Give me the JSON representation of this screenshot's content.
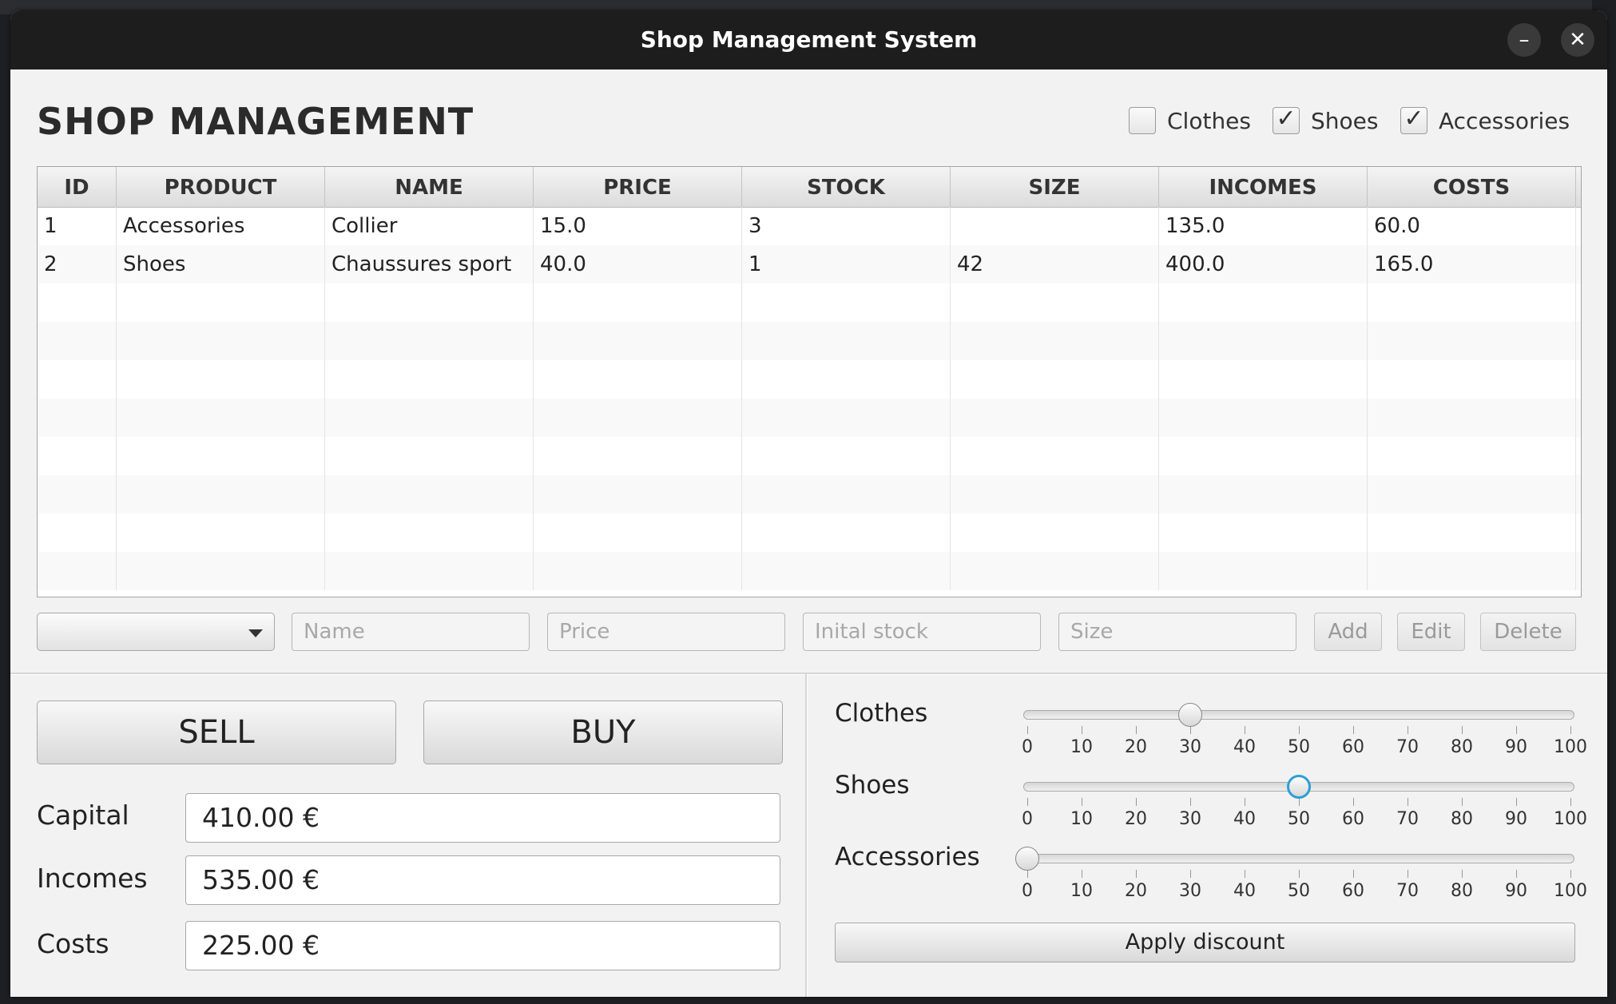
{
  "window": {
    "title": "Shop Management System",
    "minimize_glyph": "–",
    "close_glyph": "✕"
  },
  "heading": "SHOP MANAGEMENT",
  "filters": [
    {
      "label": "Clothes",
      "checked": false
    },
    {
      "label": "Shoes",
      "checked": true
    },
    {
      "label": "Accessories",
      "checked": true
    }
  ],
  "check_glyph": "✓",
  "table": {
    "columns": [
      "ID",
      "PRODUCT",
      "NAME",
      "PRICE",
      "STOCK",
      "SIZE",
      "INCOMES",
      "COSTS"
    ],
    "rows": [
      [
        "1",
        "Accessories",
        "Collier",
        "15.0",
        "3",
        "",
        "135.0",
        "60.0"
      ],
      [
        "2",
        "Shoes",
        "Chaussures sport",
        "40.0",
        "1",
        "42",
        "400.0",
        "165.0"
      ]
    ]
  },
  "form": {
    "product_combo_value": "",
    "name_placeholder": "Name",
    "price_placeholder": "Price",
    "stock_placeholder": "Inital stock",
    "size_placeholder": "Size",
    "add_label": "Add",
    "edit_label": "Edit",
    "delete_label": "Delete"
  },
  "actions": {
    "sell_label": "SELL",
    "buy_label": "BUY"
  },
  "finance": {
    "capital_label": "Capital",
    "capital_value": "410.00 €",
    "incomes_label": "Incomes",
    "incomes_value": "535.00 €",
    "costs_label": "Costs",
    "costs_value": "225.00 €"
  },
  "discounts": {
    "tick_labels": [
      "0",
      "10",
      "20",
      "30",
      "40",
      "50",
      "60",
      "70",
      "80",
      "90",
      "100"
    ],
    "sliders": [
      {
        "label": "Clothes",
        "value": 30,
        "focused": false
      },
      {
        "label": "Shoes",
        "value": 50,
        "focused": true
      },
      {
        "label": "Accessories",
        "value": 0,
        "focused": false
      }
    ],
    "apply_label": "Apply discount"
  },
  "icons": {
    "dropdown": "chevron-down-icon",
    "close": "close-icon",
    "minimize": "minimize-icon",
    "check": "check-icon"
  }
}
